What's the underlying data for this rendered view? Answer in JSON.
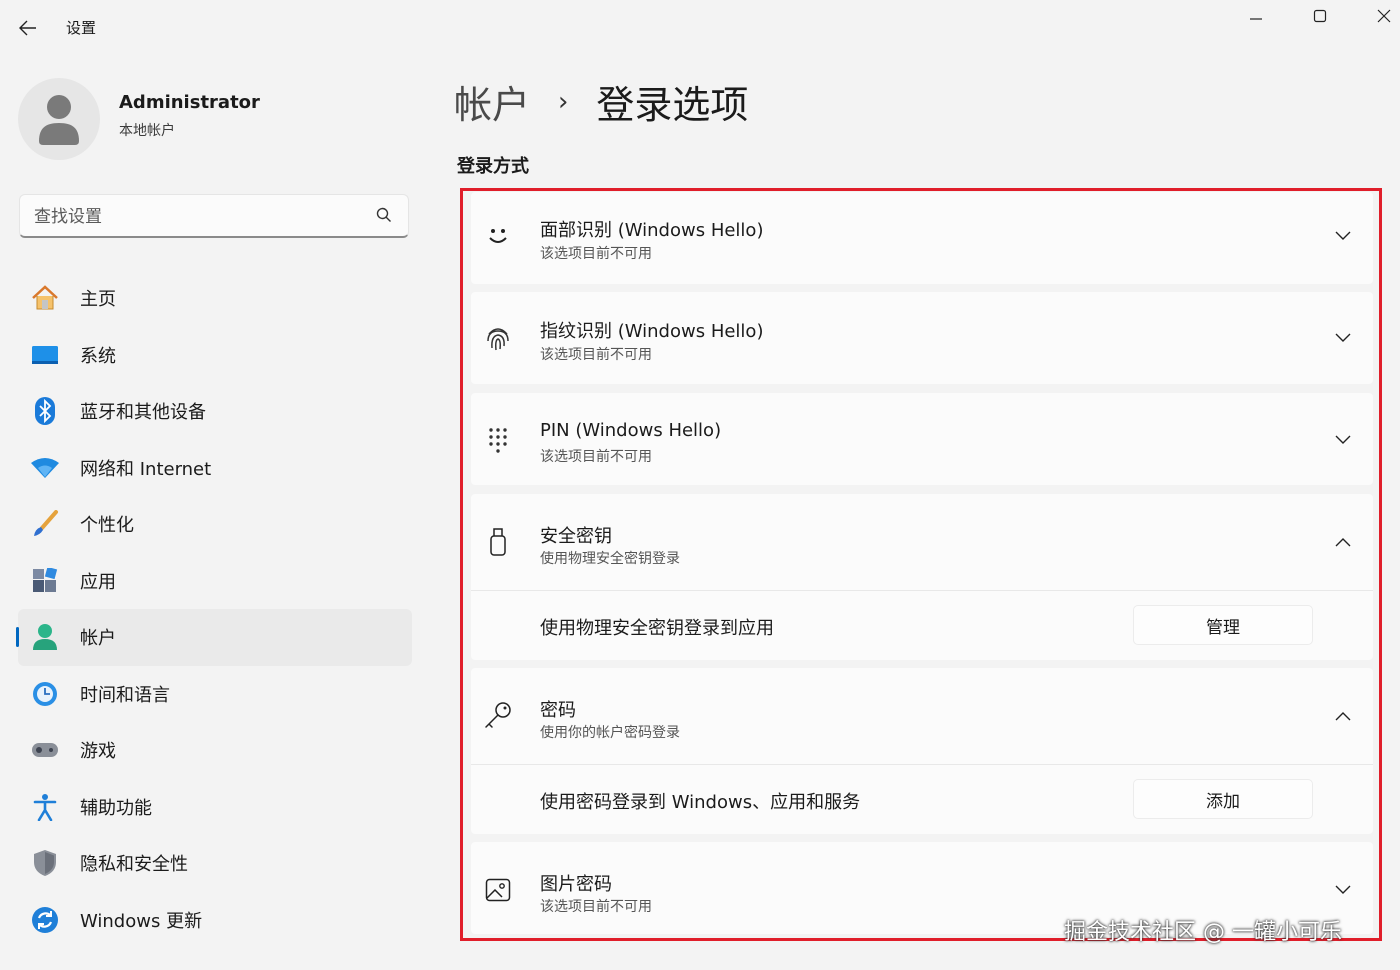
{
  "window": {
    "title": "设置",
    "back_icon": "arrow-left-icon",
    "controls": [
      "minimize-icon",
      "maximize-icon",
      "close-icon"
    ]
  },
  "profile": {
    "name": "Administrator",
    "account_type": "本地帐户"
  },
  "search": {
    "placeholder": "查找设置"
  },
  "nav": {
    "items": [
      {
        "label": "主页",
        "icon": "home-icon"
      },
      {
        "label": "系统",
        "icon": "system-icon"
      },
      {
        "label": "蓝牙和其他设备",
        "icon": "bluetooth-icon"
      },
      {
        "label": "网络和 Internet",
        "icon": "wifi-icon"
      },
      {
        "label": "个性化",
        "icon": "brush-icon"
      },
      {
        "label": "应用",
        "icon": "apps-icon"
      },
      {
        "label": "帐户",
        "icon": "account-icon",
        "active": true
      },
      {
        "label": "时间和语言",
        "icon": "time-language-icon"
      },
      {
        "label": "游戏",
        "icon": "gamepad-icon"
      },
      {
        "label": "辅助功能",
        "icon": "accessibility-icon"
      },
      {
        "label": "隐私和安全性",
        "icon": "shield-icon"
      },
      {
        "label": "Windows 更新",
        "icon": "update-icon"
      }
    ]
  },
  "breadcrumb": {
    "parent": "帐户",
    "separator": "›",
    "current": "登录选项"
  },
  "section": {
    "title": "登录方式"
  },
  "options": {
    "face": {
      "title": "面部识别 (Windows Hello)",
      "subtitle": "该选项目前不可用"
    },
    "fingerprint": {
      "title": "指纹识别 (Windows Hello)",
      "subtitle": "该选项目前不可用"
    },
    "pin": {
      "title": "PIN (Windows Hello)",
      "subtitle": "该选项目前不可用"
    },
    "security_key": {
      "title": "安全密钥",
      "subtitle": "使用物理安全密钥登录",
      "sub_label": "使用物理安全密钥登录到应用",
      "button": "管理"
    },
    "password": {
      "title": "密码",
      "subtitle": "使用你的帐户密码登录",
      "sub_label": "使用密码登录到 Windows、应用和服务",
      "button": "添加"
    },
    "picture": {
      "title": "图片密码",
      "subtitle": "该选项目前不可用"
    }
  },
  "colors": {
    "accent": "#0067c0",
    "highlight_border": "#e01e2a"
  },
  "watermark": "掘金技术社区 @ 一罐小可乐"
}
